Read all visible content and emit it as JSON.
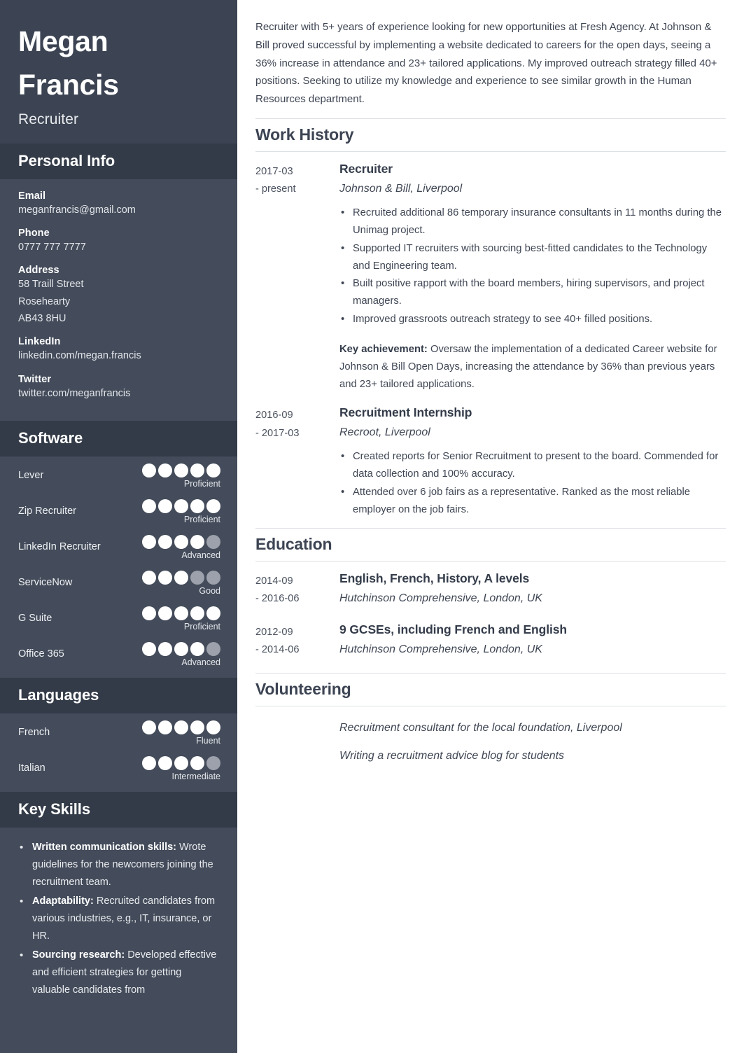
{
  "sidebar": {
    "name_line1": "Megan",
    "name_line2": "Francis",
    "role": "Recruiter",
    "personal_info": {
      "heading": "Personal Info",
      "items": [
        {
          "label": "Email",
          "lines": [
            "meganfrancis@gmail.com"
          ]
        },
        {
          "label": "Phone",
          "lines": [
            "0777 777 7777"
          ]
        },
        {
          "label": "Address",
          "lines": [
            "58 Traill Street",
            "Rosehearty",
            "AB43 8HU"
          ]
        },
        {
          "label": "LinkedIn",
          "lines": [
            "linkedin.com/megan.francis"
          ]
        },
        {
          "label": "Twitter",
          "lines": [
            "twitter.com/meganfrancis"
          ]
        }
      ]
    },
    "software": {
      "heading": "Software",
      "max_dots": 5,
      "items": [
        {
          "name": "Lever",
          "filled": 5,
          "level": "Proficient"
        },
        {
          "name": "Zip Recruiter",
          "filled": 5,
          "level": "Proficient"
        },
        {
          "name": "LinkedIn Recruiter",
          "filled": 4,
          "level": "Advanced"
        },
        {
          "name": "ServiceNow",
          "filled": 3,
          "level": "Good"
        },
        {
          "name": "G Suite",
          "filled": 5,
          "level": "Proficient"
        },
        {
          "name": "Office 365",
          "filled": 4,
          "level": "Advanced"
        }
      ]
    },
    "languages": {
      "heading": "Languages",
      "max_dots": 5,
      "items": [
        {
          "name": "French",
          "filled": 5,
          "level": "Fluent"
        },
        {
          "name": "Italian",
          "filled": 4,
          "level": "Intermediate"
        }
      ]
    },
    "key_skills": {
      "heading": "Key Skills",
      "items": [
        {
          "term": "Written communication skills:",
          "detail": " Wrote guidelines for the newcomers joining the recruitment team."
        },
        {
          "term": "Adaptability:",
          "detail": " Recruited candidates from various industries, e.g., IT, insurance, or HR."
        },
        {
          "term": "Sourcing research:",
          "detail": " Developed effective and efficient strategies for getting valuable candidates from"
        }
      ]
    }
  },
  "main": {
    "summary": "Recruiter with 5+ years of experience looking for new opportunities at Fresh Agency. At Johnson & Bill proved successful by implementing a website dedicated to careers for the open days, seeing a 36% increase in attendance and 23+ tailored applications. My improved outreach strategy filled 40+ positions. Seeking to utilize my knowledge and experience to see similar growth in the Human Resources department.",
    "work_history": {
      "heading": "Work History",
      "entries": [
        {
          "date_start": "2017-03",
          "date_end": "- present",
          "title": "Recruiter",
          "subtitle": "Johnson & Bill, Liverpool",
          "bullets": [
            "Recruited additional 86 temporary insurance consultants in 11 months during the Unimag project.",
            "Supported IT recruiters with sourcing best-fitted candidates to the Technology and Engineering team.",
            "Built positive rapport with the board members, hiring supervisors, and project managers.",
            "Improved grassroots outreach strategy to see 40+ filled positions."
          ],
          "achievement_label": "Key achievement:",
          "achievement_text": " Oversaw the implementation of a dedicated Career website for Johnson & Bill Open Days, increasing the attendance by 36% than previous years and 23+ tailored applications."
        },
        {
          "date_start": "2016-09",
          "date_end": "- 2017-03",
          "title": "Recruitment Internship",
          "subtitle": "Recroot, Liverpool",
          "bullets": [
            "Created reports for Senior Recruitment to present to the board. Commended for data collection and 100% accuracy.",
            "Attended over 6 job fairs as a representative. Ranked as the most reliable employer on the job fairs."
          ],
          "achievement_label": "",
          "achievement_text": ""
        }
      ]
    },
    "education": {
      "heading": "Education",
      "entries": [
        {
          "date_start": "2014-09",
          "date_end": "- 2016-06",
          "title": "English, French, History, A levels",
          "subtitle": "Hutchinson Comprehensive, London, UK"
        },
        {
          "date_start": "2012-09",
          "date_end": "- 2014-06",
          "title": "9 GCSEs, including French and English",
          "subtitle": "Hutchinson Comprehensive, London, UK"
        }
      ]
    },
    "volunteering": {
      "heading": "Volunteering",
      "entries": [
        {
          "text": "Recruitment consultant for the local foundation, Liverpool"
        },
        {
          "text": "Writing a recruitment advice blog for students"
        }
      ]
    }
  },
  "colors": {
    "sidebar_bg": "#444c5b",
    "sidebar_band": "#333b48",
    "sidebar_head": "#3c4453",
    "dot_on": "#ffffff",
    "dot_off": "#9ca1ab",
    "main_text": "#3f4654",
    "rule": "#dcdfe3"
  }
}
